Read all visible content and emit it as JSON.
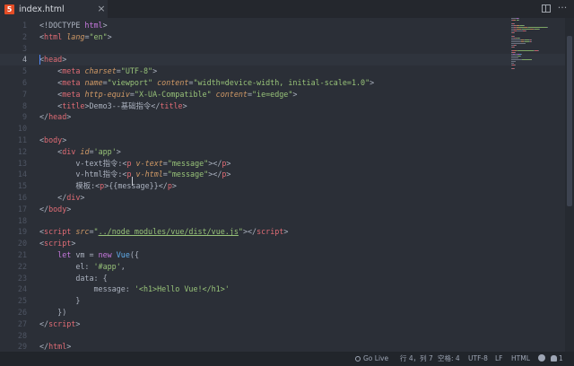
{
  "tab": {
    "filename": "index.html",
    "icon": "html5-icon"
  },
  "editor": {
    "current_line": 4,
    "lines": [
      {
        "n": "1",
        "tokens": [
          [
            "p",
            "<!DOCTYPE "
          ],
          [
            "k",
            "html"
          ],
          [
            "p",
            ">"
          ]
        ]
      },
      {
        "n": "2",
        "tokens": [
          [
            "p",
            "<"
          ],
          [
            "t",
            "html"
          ],
          [
            "p",
            " "
          ],
          [
            "a",
            "lang"
          ],
          [
            "p",
            "="
          ],
          [
            "s",
            "\"en\""
          ],
          [
            "p",
            ">"
          ]
        ]
      },
      {
        "n": "3",
        "tokens": []
      },
      {
        "n": "4",
        "tokens": [
          [
            "p",
            "<"
          ],
          [
            "t",
            "head"
          ],
          [
            "p",
            ">"
          ]
        ]
      },
      {
        "n": "5",
        "tokens": [
          [
            "p",
            "    <"
          ],
          [
            "t",
            "meta"
          ],
          [
            "p",
            " "
          ],
          [
            "a",
            "charset"
          ],
          [
            "p",
            "="
          ],
          [
            "s",
            "\"UTF-8\""
          ],
          [
            "p",
            ">"
          ]
        ]
      },
      {
        "n": "6",
        "tokens": [
          [
            "p",
            "    <"
          ],
          [
            "t",
            "meta"
          ],
          [
            "p",
            " "
          ],
          [
            "a",
            "name"
          ],
          [
            "p",
            "="
          ],
          [
            "s",
            "\"viewport\""
          ],
          [
            "p",
            " "
          ],
          [
            "a",
            "content"
          ],
          [
            "p",
            "="
          ],
          [
            "s",
            "\"width=device-width, initial-scale=1.0\""
          ],
          [
            "p",
            ">"
          ]
        ]
      },
      {
        "n": "7",
        "tokens": [
          [
            "p",
            "    <"
          ],
          [
            "t",
            "meta"
          ],
          [
            "p",
            " "
          ],
          [
            "a",
            "http-equiv"
          ],
          [
            "p",
            "="
          ],
          [
            "s",
            "\"X-UA-Compatible\""
          ],
          [
            "p",
            " "
          ],
          [
            "a",
            "content"
          ],
          [
            "p",
            "="
          ],
          [
            "s",
            "\"ie=edge\""
          ],
          [
            "p",
            ">"
          ]
        ]
      },
      {
        "n": "8",
        "tokens": [
          [
            "p",
            "    <"
          ],
          [
            "t",
            "title"
          ],
          [
            "p",
            ">Demo3--基础指令</"
          ],
          [
            "t",
            "title"
          ],
          [
            "p",
            ">"
          ]
        ]
      },
      {
        "n": "9",
        "tokens": [
          [
            "p",
            "</"
          ],
          [
            "t",
            "head"
          ],
          [
            "p",
            ">"
          ]
        ]
      },
      {
        "n": "10",
        "tokens": []
      },
      {
        "n": "11",
        "tokens": [
          [
            "p",
            "<"
          ],
          [
            "t",
            "body"
          ],
          [
            "p",
            ">"
          ]
        ]
      },
      {
        "n": "12",
        "tokens": [
          [
            "p",
            "    <"
          ],
          [
            "t",
            "div"
          ],
          [
            "p",
            " "
          ],
          [
            "a",
            "id"
          ],
          [
            "p",
            "="
          ],
          [
            "s",
            "'app'"
          ],
          [
            "p",
            ">"
          ]
        ]
      },
      {
        "n": "13",
        "tokens": [
          [
            "p",
            "        v-text指令:<"
          ],
          [
            "t",
            "p"
          ],
          [
            "p",
            " "
          ],
          [
            "a",
            "v-text"
          ],
          [
            "p",
            "="
          ],
          [
            "s",
            "\"message\""
          ],
          [
            "p",
            "></"
          ],
          [
            "t",
            "p"
          ],
          [
            "p",
            ">"
          ]
        ]
      },
      {
        "n": "14",
        "tokens": [
          [
            "p",
            "        v-html指令:<"
          ],
          [
            "t",
            "p"
          ],
          [
            "p",
            " "
          ],
          [
            "a",
            "v-html"
          ],
          [
            "p",
            "="
          ],
          [
            "s",
            "\"message\""
          ],
          [
            "p",
            "></"
          ],
          [
            "t",
            "p"
          ],
          [
            "p",
            ">"
          ]
        ]
      },
      {
        "n": "15",
        "tokens": [
          [
            "p",
            "        模板:<"
          ],
          [
            "t",
            "p"
          ],
          [
            "p",
            ">{{message}}</"
          ],
          [
            "t",
            "p"
          ],
          [
            "p",
            ">"
          ]
        ]
      },
      {
        "n": "16",
        "tokens": [
          [
            "p",
            "    </"
          ],
          [
            "t",
            "div"
          ],
          [
            "p",
            ">"
          ]
        ]
      },
      {
        "n": "17",
        "tokens": [
          [
            "p",
            "</"
          ],
          [
            "t",
            "body"
          ],
          [
            "p",
            ">"
          ]
        ]
      },
      {
        "n": "18",
        "tokens": []
      },
      {
        "n": "19",
        "tokens": [
          [
            "p",
            "<"
          ],
          [
            "t",
            "script"
          ],
          [
            "p",
            " "
          ],
          [
            "a",
            "src"
          ],
          [
            "p",
            "="
          ],
          [
            "s",
            "\""
          ],
          [
            "u",
            "../node_modules/vue/dist/vue.js"
          ],
          [
            "s",
            "\""
          ],
          [
            "p",
            "></"
          ],
          [
            "t",
            "script"
          ],
          [
            "p",
            ">"
          ]
        ]
      },
      {
        "n": "20",
        "tokens": [
          [
            "p",
            "<"
          ],
          [
            "t",
            "script"
          ],
          [
            "p",
            ">"
          ]
        ]
      },
      {
        "n": "21",
        "tokens": [
          [
            "p",
            "    "
          ],
          [
            "k",
            "let"
          ],
          [
            "p",
            " vm = "
          ],
          [
            "k",
            "new"
          ],
          [
            "p",
            " "
          ],
          [
            "f",
            "Vue"
          ],
          [
            "p",
            "({"
          ]
        ]
      },
      {
        "n": "22",
        "tokens": [
          [
            "p",
            "        el: "
          ],
          [
            "s",
            "'#app'"
          ],
          [
            "p",
            ","
          ]
        ]
      },
      {
        "n": "23",
        "tokens": [
          [
            "p",
            "        data: {"
          ]
        ]
      },
      {
        "n": "24",
        "tokens": [
          [
            "p",
            "            message: "
          ],
          [
            "s",
            "'<h1>Hello Vue!</h1>'"
          ]
        ]
      },
      {
        "n": "25",
        "tokens": [
          [
            "p",
            "        }"
          ]
        ]
      },
      {
        "n": "26",
        "tokens": [
          [
            "p",
            "    })"
          ]
        ]
      },
      {
        "n": "27",
        "tokens": [
          [
            "p",
            "</"
          ],
          [
            "t",
            "script"
          ],
          [
            "p",
            ">"
          ]
        ]
      },
      {
        "n": "28",
        "tokens": []
      },
      {
        "n": "29",
        "tokens": [
          [
            "p",
            "</"
          ],
          [
            "t",
            "html"
          ],
          [
            "p",
            ">"
          ]
        ]
      }
    ]
  },
  "status": {
    "go_live": "Go Live",
    "position": "行 4，列 7",
    "indent": "空格: 4",
    "encoding": "UTF-8",
    "eol": "LF",
    "language": "HTML",
    "notifications": "1"
  },
  "colors": {
    "background": "#2b2f37",
    "tag": "#e06c75",
    "attribute": "#d19a66",
    "string": "#98c379",
    "keyword": "#c678dd"
  }
}
